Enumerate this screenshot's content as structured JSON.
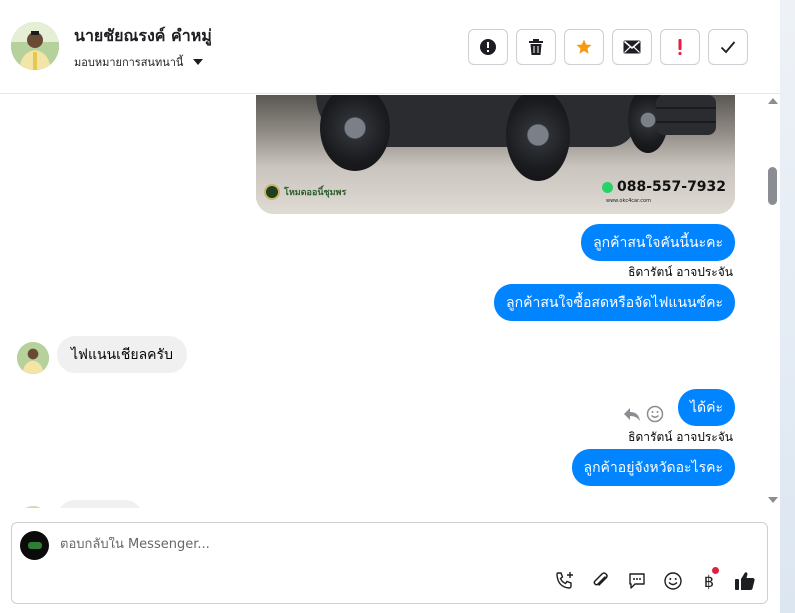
{
  "header": {
    "name": "นายชัยณรงค์ คำหมู่",
    "assign_label": "มอบหมายการสนทนานี้",
    "actions": [
      {
        "name": "spam-alert-button",
        "icon": "alert-circle-icon"
      },
      {
        "name": "delete-button",
        "icon": "trash-icon"
      },
      {
        "name": "star-button",
        "icon": "star-icon"
      },
      {
        "name": "mark-unread-button",
        "icon": "envelope-icon"
      },
      {
        "name": "follow-up-button",
        "icon": "exclamation-icon"
      },
      {
        "name": "mark-done-button",
        "icon": "check-icon"
      }
    ]
  },
  "colors": {
    "accent": "#0084ff",
    "star": "#f39c12",
    "follow_up": "#e41e3f",
    "incoming_bubble": "#f0f0f0"
  },
  "photo": {
    "brand": "โหมดออนิ์ชุมพร",
    "phone": "088-557-7932",
    "website": "www.okc4car.com"
  },
  "messages": [
    {
      "dir": "out",
      "text": "ลูกค้าสนใจคันนี้นะคะ"
    },
    {
      "dir": "out",
      "sender": "ธิดารัตน์ อาจประจัน",
      "text": "ลูกค้าสนใจซื้อสดหรือจัดไฟแนนซ์คะ"
    },
    {
      "dir": "in",
      "text": "ไฟแนนเชียลครับ"
    },
    {
      "dir": "out",
      "text": "ได้ค่ะ"
    },
    {
      "dir": "out",
      "sender": "ธิดารัตน์ อาจประจัน",
      "text": "ลูกค้าอยู่จังหวัดอะไรคะ"
    }
  ],
  "composer": {
    "placeholder": "ตอบกลับใน Messenger...",
    "tools": [
      "call-add-icon",
      "paperclip-icon",
      "chat-bubble-icon",
      "emoji-icon",
      "baht-icon",
      "thumbs-up-icon"
    ]
  }
}
